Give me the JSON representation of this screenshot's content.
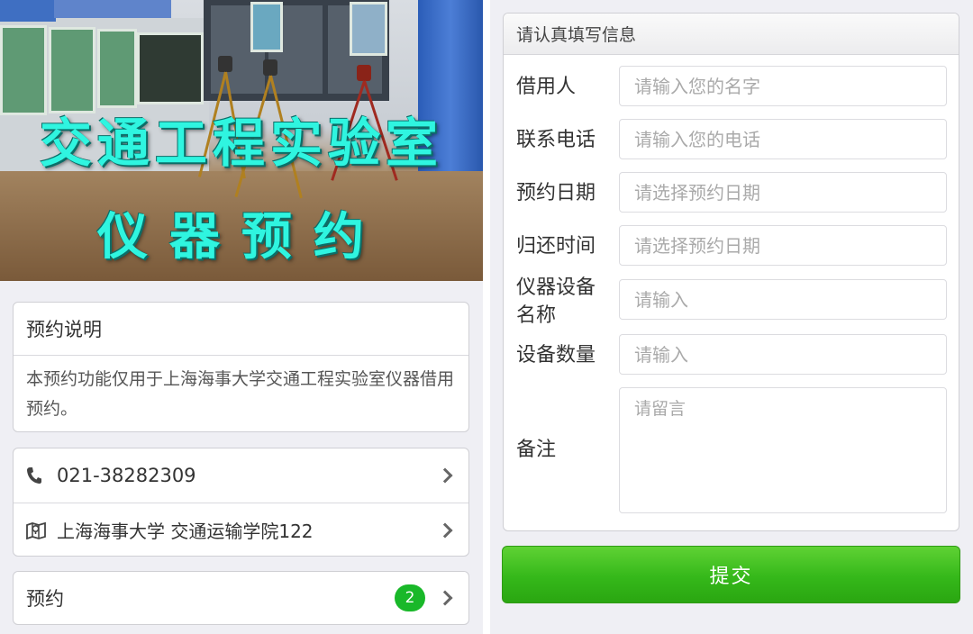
{
  "banner": {
    "title_line1": "交通工程实验室",
    "title_line2": "仪器预约"
  },
  "notice": {
    "title": "预约说明",
    "body": "本预约功能仅用于上海海事大学交通工程实验室仪器借用预约。"
  },
  "contacts": {
    "phone": "021-38282309",
    "address": "上海海事大学 交通运输学院122"
  },
  "booking": {
    "label": "预约",
    "badge_count": "2"
  },
  "form": {
    "header": "请认真填写信息",
    "fields": [
      {
        "label": "借用人",
        "placeholder": "请输入您的名字"
      },
      {
        "label": "联系电话",
        "placeholder": "请输入您的电话"
      },
      {
        "label": "预约日期",
        "placeholder": "请选择预约日期"
      },
      {
        "label": "归还时间",
        "placeholder": "请选择预约日期"
      },
      {
        "label_line1": "仪器设备",
        "label_line2": "名称",
        "placeholder": "请输入"
      },
      {
        "label": "设备数量",
        "placeholder": "请输入"
      },
      {
        "label": "备注",
        "placeholder": "请留言"
      }
    ],
    "submit_label": "提交"
  },
  "icons": {
    "phone": "phone-icon",
    "map": "map-pin-icon",
    "chevron": "chevron-right-icon"
  },
  "colors": {
    "accent_green": "#35b81a",
    "badge_green": "#19b829",
    "banner_text": "#2ff5e0"
  }
}
